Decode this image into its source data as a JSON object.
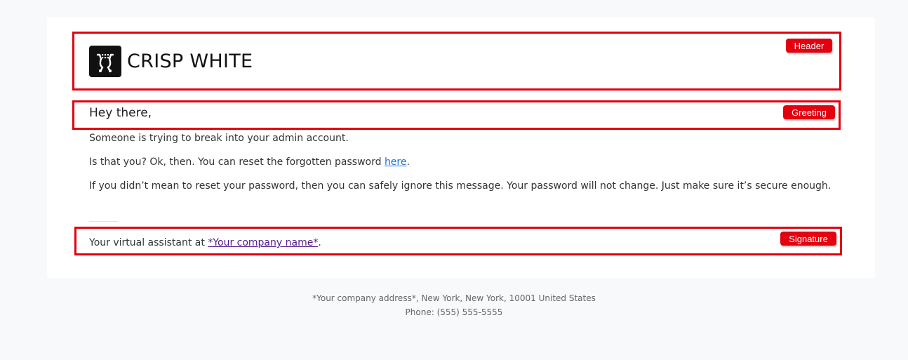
{
  "header": {
    "logo_icon": "shopping-cart-icon",
    "brand_name": "CRISP WHITE",
    "annotation_label": "Header"
  },
  "greeting": {
    "text": "Hey there,",
    "annotation_label": "Greeting"
  },
  "body": {
    "line1": "Someone is trying to break into your admin account.",
    "line2_prefix": "Is that you? Ok, then. You can reset the forgotten password ",
    "line2_link": "here",
    "line2_suffix": ".",
    "line3": "If you didn’t mean to reset your password, then you can safely ignore this message. Your password will not change. Just make sure it’s secure enough."
  },
  "signature": {
    "prefix": "Your virtual assistant at ",
    "company_link": "*Your company name*",
    "suffix": ".",
    "annotation_label": "Signature"
  },
  "footer": {
    "address": "*Your company address*, New York, New York, 10001 United States",
    "phone": "Phone: (555) 555-5555"
  },
  "colors": {
    "annotation_red": "#e3000f",
    "link_blue": "#1a73e8",
    "link_purple": "#551a8b",
    "page_bg": "#f8f9fa",
    "card_bg": "#ffffff"
  }
}
